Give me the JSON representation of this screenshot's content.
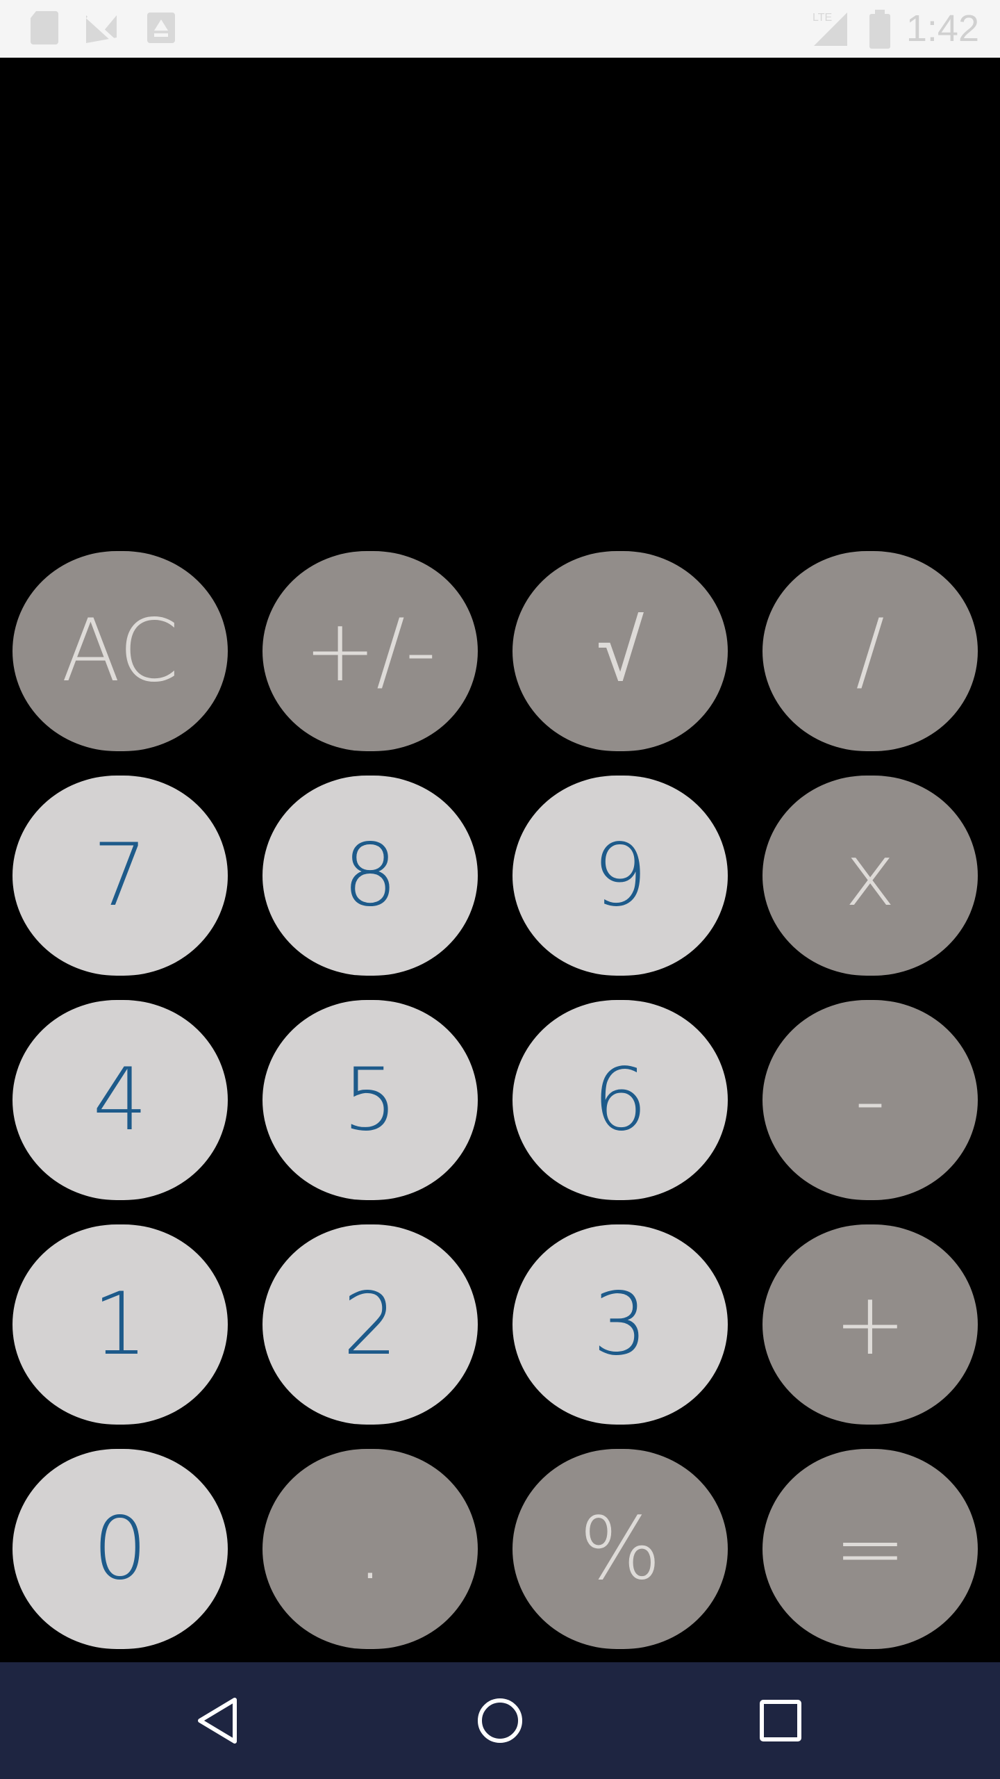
{
  "status_bar": {
    "time": "1:42",
    "network": "LTE",
    "icons": [
      "sd-card-icon",
      "no-signal-icon",
      "download-icon",
      "signal-icon",
      "battery-icon"
    ]
  },
  "display": {
    "value": ""
  },
  "keypad": {
    "rows": [
      [
        {
          "label": "AC",
          "name": "clear-button",
          "kind": "op"
        },
        {
          "label": "+/-",
          "name": "sign-toggle-button",
          "kind": "op"
        },
        {
          "label": "√",
          "name": "square-root-button",
          "kind": "op"
        },
        {
          "label": "/",
          "name": "divide-button",
          "kind": "op"
        }
      ],
      [
        {
          "label": "7",
          "name": "digit-7-button",
          "kind": "num"
        },
        {
          "label": "8",
          "name": "digit-8-button",
          "kind": "num"
        },
        {
          "label": "9",
          "name": "digit-9-button",
          "kind": "num"
        },
        {
          "label": "x",
          "name": "multiply-button",
          "kind": "op"
        }
      ],
      [
        {
          "label": "4",
          "name": "digit-4-button",
          "kind": "num"
        },
        {
          "label": "5",
          "name": "digit-5-button",
          "kind": "num"
        },
        {
          "label": "6",
          "name": "digit-6-button",
          "kind": "num"
        },
        {
          "label": "-",
          "name": "subtract-button",
          "kind": "op"
        }
      ],
      [
        {
          "label": "1",
          "name": "digit-1-button",
          "kind": "num"
        },
        {
          "label": "2",
          "name": "digit-2-button",
          "kind": "num"
        },
        {
          "label": "3",
          "name": "digit-3-button",
          "kind": "num"
        },
        {
          "label": "+",
          "name": "add-button",
          "kind": "op"
        }
      ],
      [
        {
          "label": "0",
          "name": "digit-0-button",
          "kind": "num"
        },
        {
          "label": ".",
          "name": "decimal-button",
          "kind": "op"
        },
        {
          "label": "%",
          "name": "percent-button",
          "kind": "op"
        },
        {
          "label": "=",
          "name": "equals-button",
          "kind": "op"
        }
      ]
    ]
  },
  "nav_bar": {
    "buttons": [
      "back-icon",
      "home-icon",
      "recents-icon"
    ]
  },
  "colors": {
    "number_key_bg": "#d4d2d2",
    "number_key_text": "#1d5a8a",
    "operator_key_bg": "#928d8a",
    "operator_key_text": "#dedbd8",
    "nav_bar_bg": "#1e2541",
    "background": "#000000"
  }
}
